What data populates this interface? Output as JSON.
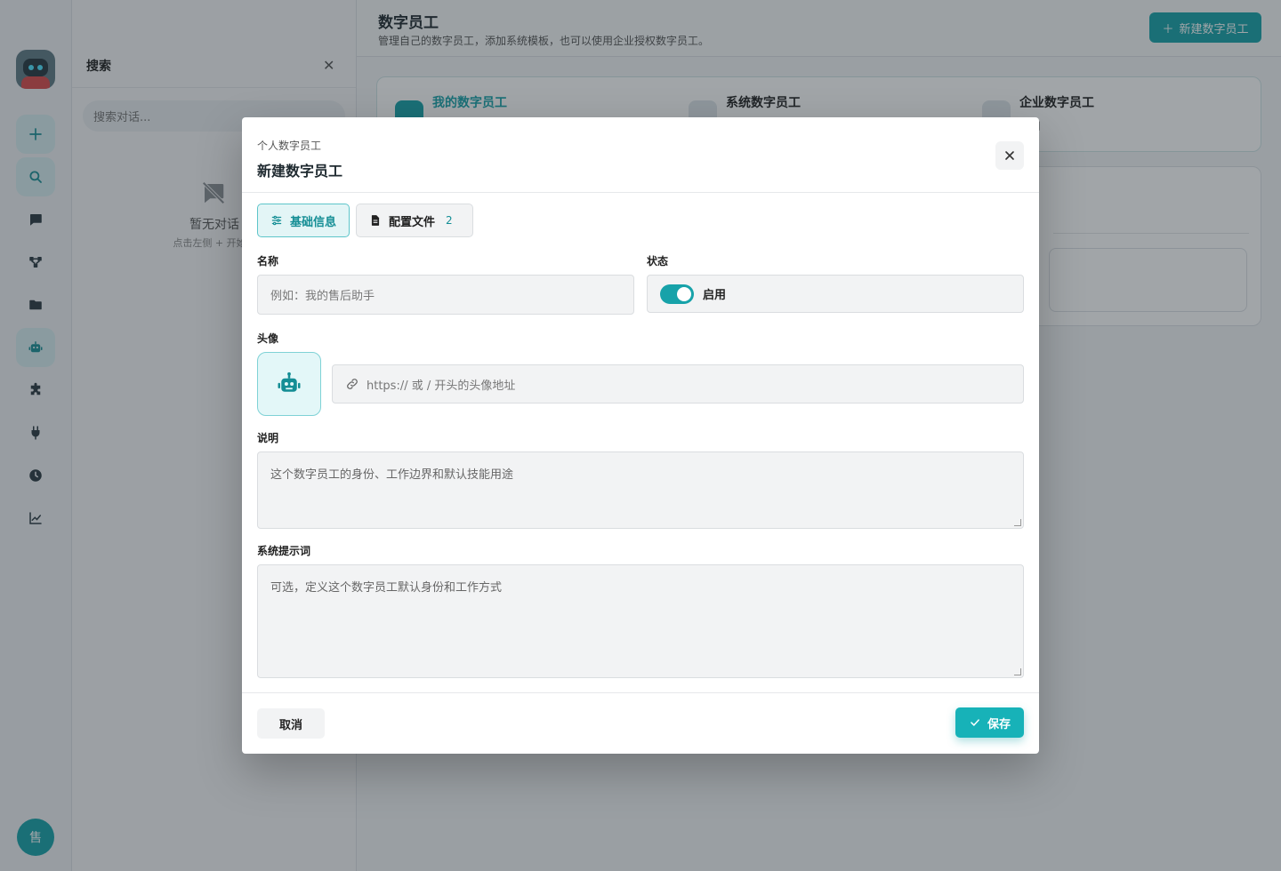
{
  "app": {
    "rail": {
      "logo": "robot-logo",
      "items": [
        {
          "icon": "plus-icon"
        },
        {
          "icon": "search-icon"
        },
        {
          "icon": "chat-icon"
        },
        {
          "icon": "workflow-icon"
        },
        {
          "icon": "folder-icon"
        },
        {
          "icon": "robot-icon"
        },
        {
          "icon": "puzzle-icon"
        },
        {
          "icon": "plug-icon"
        },
        {
          "icon": "clock-icon"
        },
        {
          "icon": "chart-icon"
        }
      ],
      "user_avatar": "售"
    },
    "search_panel": {
      "title": "搜索",
      "placeholder": "搜索对话...",
      "empty_title": "暂无对话",
      "empty_sub": "点击左侧 + 开始新"
    },
    "main": {
      "title": "数字员工",
      "subtitle": "管理自己的数字员工，添加系统模板，也可以使用企业授权数字员工。",
      "new_button": "新建数字员工",
      "tabs": [
        {
          "label": "我的数字员工",
          "desc": ""
        },
        {
          "label": "系统数字员工",
          "desc": ""
        },
        {
          "label": "企业数字员工",
          "desc": "可用"
        }
      ]
    }
  },
  "modal": {
    "eyebrow": "个人数字员工",
    "title": "新建数字员工",
    "tabs": [
      {
        "label": "基础信息",
        "icon": "sliders-icon"
      },
      {
        "label": "配置文件",
        "icon": "document-icon",
        "count": "2"
      }
    ],
    "fields": {
      "name": {
        "label": "名称",
        "placeholder": "例如：我的售后助手"
      },
      "status": {
        "label": "状态",
        "value": "启用",
        "enabled": true
      },
      "avatar": {
        "label": "头像",
        "placeholder": "https:// 或 / 开头的头像地址"
      },
      "description": {
        "label": "说明",
        "placeholder": "这个数字员工的身份、工作边界和默认技能用途"
      },
      "system_prompt": {
        "label": "系统提示词",
        "placeholder": "可选，定义这个数字员工默认身份和工作方式"
      }
    },
    "footer": {
      "cancel": "取消",
      "save": "保存"
    }
  },
  "colors": {
    "accent": "#17a2a9",
    "overlay": "#1e2830"
  }
}
